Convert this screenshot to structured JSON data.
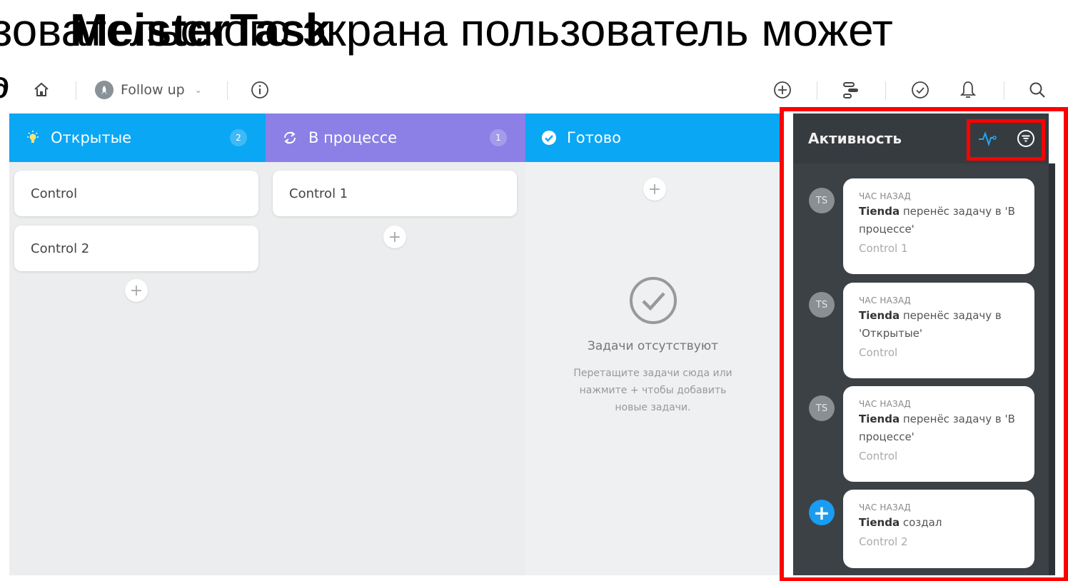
{
  "slide": {
    "title_back": "зовательского экрана пользователь может",
    "title_front": "MeisterTask",
    "title_fragment": "д"
  },
  "toolbar": {
    "project_name": "Follow up",
    "icons": [
      "home-icon",
      "project-avatar-icon",
      "chevron-down-icon",
      "info-icon",
      "add-circle-icon",
      "timeline-icon",
      "check-circle-icon",
      "bell-icon",
      "search-icon"
    ]
  },
  "columns": [
    {
      "title": "Открытые",
      "count": "2",
      "color": "#0aa7f5",
      "icon": "lightbulb-icon",
      "tasks": [
        "Control",
        "Control 2"
      ]
    },
    {
      "title": "В процессе",
      "count": "1",
      "color": "#8c7fe6",
      "icon": "sync-icon",
      "tasks": [
        "Control 1"
      ]
    },
    {
      "title": "Готово",
      "count": "",
      "color": "#0aa7f5",
      "icon": "check-circle-icon",
      "tasks": []
    }
  ],
  "empty_state": {
    "title": "Задачи отсутствуют",
    "text": "Перетащите задачи сюда или нажмите + чтобы добавить новые задачи."
  },
  "activity": {
    "title": "Активность",
    "icons": [
      "activity-pulse-icon",
      "filter-icon"
    ],
    "entries": [
      {
        "avatar": "TS",
        "time": "ЧАС НАЗАД",
        "user": "Tienda",
        "action": " перенёс задачу в 'В процессе'",
        "task": "Control 1"
      },
      {
        "avatar": "TS",
        "time": "ЧАС НАЗАД",
        "user": "Tienda",
        "action": " перенёс задачу в 'Открытые'",
        "task": "Control"
      },
      {
        "avatar": "TS",
        "time": "ЧАС НАЗАД",
        "user": "Tienda",
        "action": " перенёс задачу в 'В процессе'",
        "task": "Control"
      },
      {
        "avatar": "+",
        "time": "ЧАС НАЗАД",
        "user": "Tienda",
        "action": " создал",
        "task": "Control 2"
      }
    ]
  },
  "highlight_color": "#ff0000"
}
